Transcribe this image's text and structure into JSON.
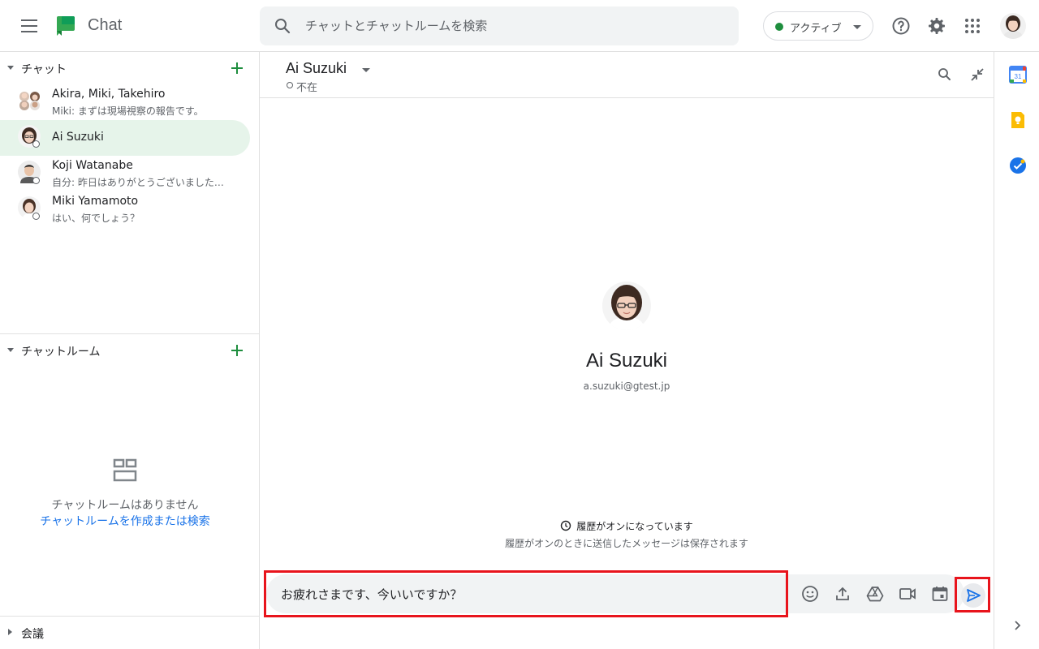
{
  "header": {
    "app_name": "Chat",
    "search_placeholder": "チャットとチャットルームを検索",
    "status_label": "アクティブ"
  },
  "sidebar": {
    "chats_title": "チャット",
    "chats": [
      {
        "name": "Akira, Miki, Takehiro",
        "preview": "Miki: まずは現場視察の報告です。"
      },
      {
        "name": "Ai Suzuki",
        "preview": ""
      },
      {
        "name": "Koji Watanabe",
        "preview": "自分: 昨日はありがとうございました…"
      },
      {
        "name": "Miki Yamamoto",
        "preview": "はい、何でしょう？"
      }
    ],
    "rooms_title": "チャットルーム",
    "rooms_empty_text": "チャットルームはありません",
    "rooms_empty_link": "チャットルームを作成または検索",
    "meetings_title": "会議"
  },
  "conversation": {
    "name": "Ai Suzuki",
    "status": "不在",
    "profile_name": "Ai Suzuki",
    "profile_email": "a.suzuki@gtest.jp",
    "history_title": "履歴がオンになっています",
    "history_sub": "履歴がオンのときに送信したメッセージは保存されます",
    "compose_value": "お疲れさまです、今いいですか？"
  },
  "rail": {
    "calendar_date": "31"
  },
  "colors": {
    "accent_green": "#1e8e3e",
    "active_bg": "#e6f4ea",
    "link_blue": "#1a73e8",
    "highlight_red": "#e8141c"
  }
}
